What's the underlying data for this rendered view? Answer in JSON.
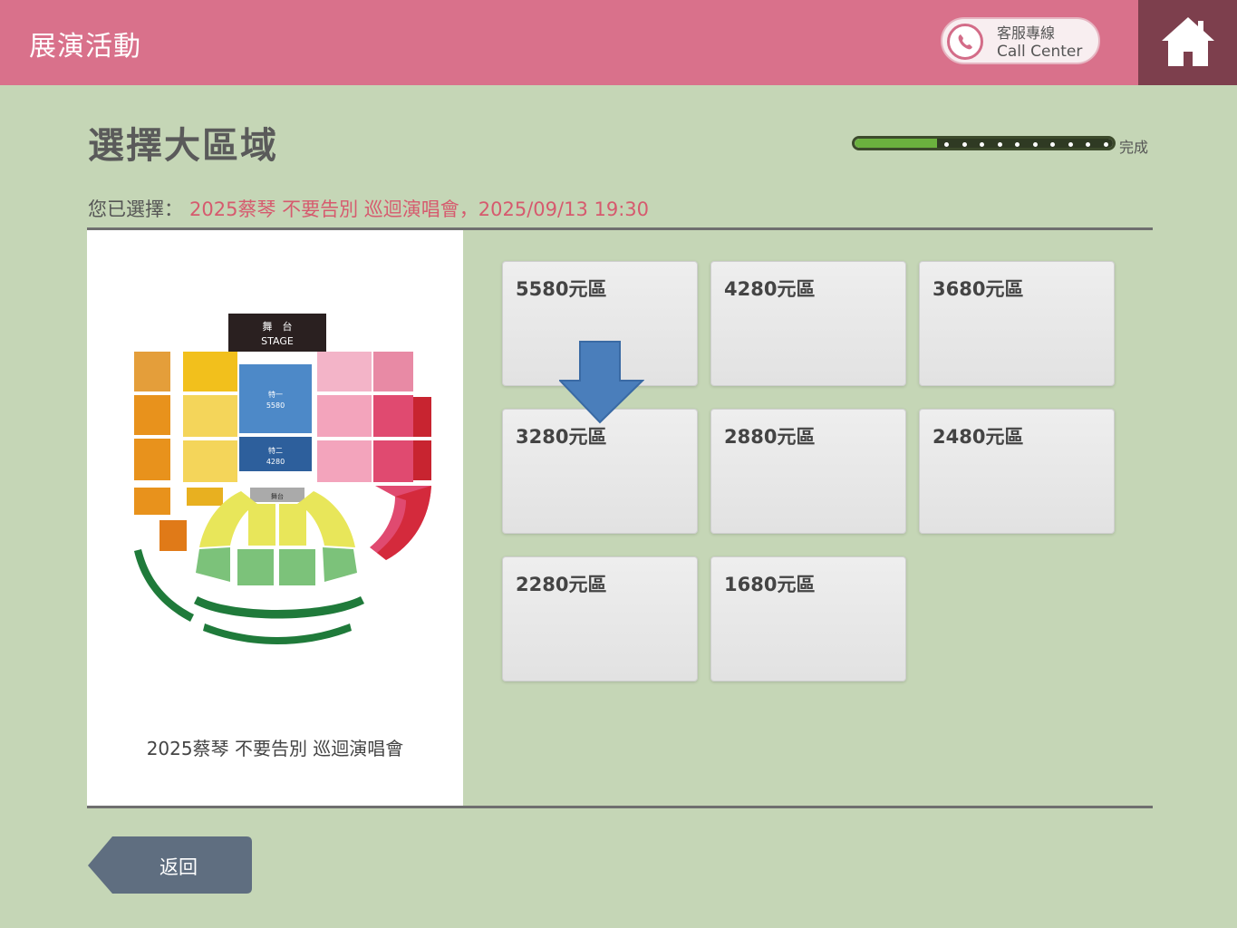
{
  "header": {
    "app_title": "展演活動",
    "call_center_line1": "客服專線",
    "call_center_line2": "Call Center",
    "home_icon": "home-icon",
    "phone_icon": "phone-icon"
  },
  "page": {
    "title": "選擇大區域",
    "progress_label": "完成",
    "progress_fraction": 0.32,
    "selected_prefix": "您已選擇：",
    "selected_value": "2025蔡琴 不要告別 巡迴演唱會，2025/09/13 19:30"
  },
  "seat_map": {
    "caption": "2025蔡琴 不要告別 巡迴演唱會",
    "stage_label_top": "舞　台",
    "stage_label_bottom": "STAGE",
    "floor_a_label": "特一",
    "floor_a_price": "5580",
    "floor_b_label": "特二",
    "floor_b_price": "4280",
    "center_label": "舞台"
  },
  "zones": [
    {
      "label": "5580元區"
    },
    {
      "label": "4280元區"
    },
    {
      "label": "3680元區"
    },
    {
      "label": "3280元區"
    },
    {
      "label": "2880元區"
    },
    {
      "label": "2480元區"
    },
    {
      "label": "2280元區"
    },
    {
      "label": "1680元區"
    }
  ],
  "footer": {
    "back_label": "返回"
  },
  "colors": {
    "header": "#d9718b",
    "home": "#7d3f4d",
    "background": "#c5d6b6",
    "accent_text": "#d65a6e",
    "arrow": "#4a7ebb"
  }
}
